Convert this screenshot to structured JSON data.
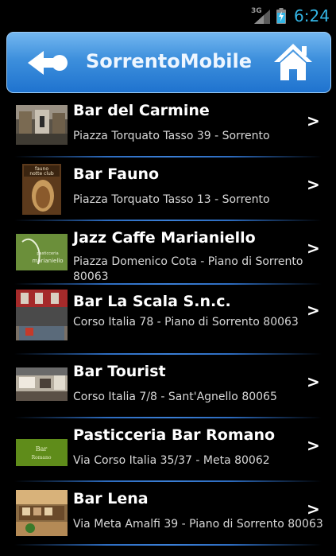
{
  "status_bar": {
    "network": "3G",
    "time": "6:24",
    "accent_color": "#33b5e5"
  },
  "header": {
    "title": "SorrentoMobile",
    "back_icon": "back-arrow-icon",
    "home_icon": "home-icon"
  },
  "chevron": ">",
  "bars": [
    {
      "name": "Bar del Carmine",
      "address": "Piazza Torquato Tasso 39 - Sorrento"
    },
    {
      "name": "Bar Fauno",
      "address": "Piazza Torquato Tasso 13 - Sorrento"
    },
    {
      "name": "Jazz Caffe Marianiello",
      "address": "Piazza Domenico Cota - Piano di Sorrento 80063"
    },
    {
      "name": "Bar La Scala S.n.c.",
      "address": "Corso Italia 78 - Piano di Sorrento 80063"
    },
    {
      "name": "Bar Tourist",
      "address": "Corso Italia 7/8 - Sant'Agnello 80065"
    },
    {
      "name": "Pasticceria Bar Romano",
      "address": "Via Corso Italia 35/37 - Meta 80062"
    },
    {
      "name": "Bar Lena",
      "address": "Via Meta Amalfi 39 - Piano di Sorrento 80063"
    }
  ]
}
